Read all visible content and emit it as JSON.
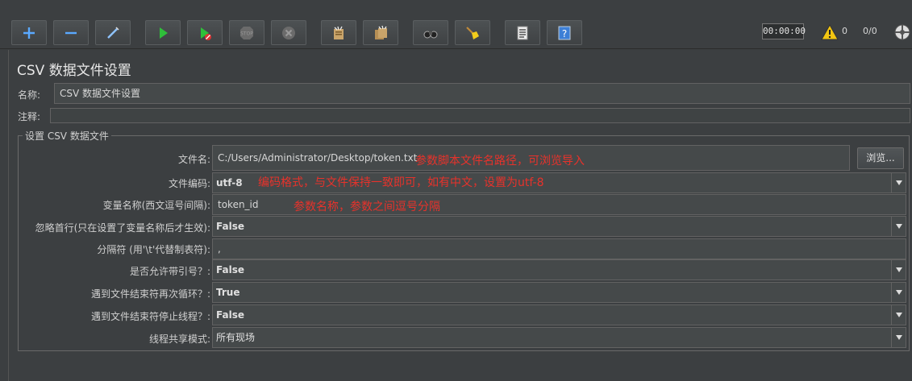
{
  "toolbar": {
    "buttons": [
      {
        "name": "add-icon"
      },
      {
        "name": "remove-icon"
      },
      {
        "name": "wand-icon"
      },
      {
        "name": "start-icon"
      },
      {
        "name": "start-no-pause-icon"
      },
      {
        "name": "stop-icon"
      },
      {
        "name": "shutdown-icon"
      },
      {
        "name": "clear-icon"
      },
      {
        "name": "clear-all-icon"
      },
      {
        "name": "search-binoculars-icon"
      },
      {
        "name": "reset-search-broom-icon"
      },
      {
        "name": "function-helper-icon"
      },
      {
        "name": "help-icon"
      }
    ],
    "timer": "00:00:00",
    "warning_count": "0",
    "threads": "0/0"
  },
  "page": {
    "title": "CSV 数据文件设置",
    "name_label": "名称:",
    "name_value": "CSV 数据文件设置",
    "comment_label": "注释:",
    "comment_value": "",
    "section_legend": "设置 CSV 数据文件"
  },
  "form": {
    "filename_label": "文件名:",
    "filename_value": "C:/Users/Administrator/Desktop/token.txt",
    "browse_label": "浏览...",
    "encoding_label": "文件编码:",
    "encoding_value": "utf-8",
    "varnames_label": "变量名称(西文逗号间隔):",
    "varnames_value": "token_id",
    "ignore_first_label": "忽略首行(只在设置了变量名称后才生效):",
    "ignore_first_value": "False",
    "delimiter_label": "分隔符 (用'\\t'代替制表符):",
    "delimiter_value": ",",
    "quoted_label": "是否允许带引号？:",
    "quoted_value": "False",
    "recycle_label": "遇到文件结束符再次循环？:",
    "recycle_value": "True",
    "stop_thread_label": "遇到文件结束符停止线程？:",
    "stop_thread_value": "False",
    "share_mode_label": "线程共享模式:",
    "share_mode_value": "所有现场"
  },
  "annotations": {
    "filename_note": "参数脚本文件名路径，可浏览导入",
    "encoding_note": "编码格式，与文件保持一致即可，如有中文，设置为utf-8",
    "varnames_note": "参数名称，参数之间逗号分隔",
    "note_color": "#e8322b"
  },
  "colors": {
    "background": "#3c3f41",
    "field_bg": "#45494a",
    "accent_green": "#2fbf3a",
    "accent_blue": "#3d7fd6"
  }
}
